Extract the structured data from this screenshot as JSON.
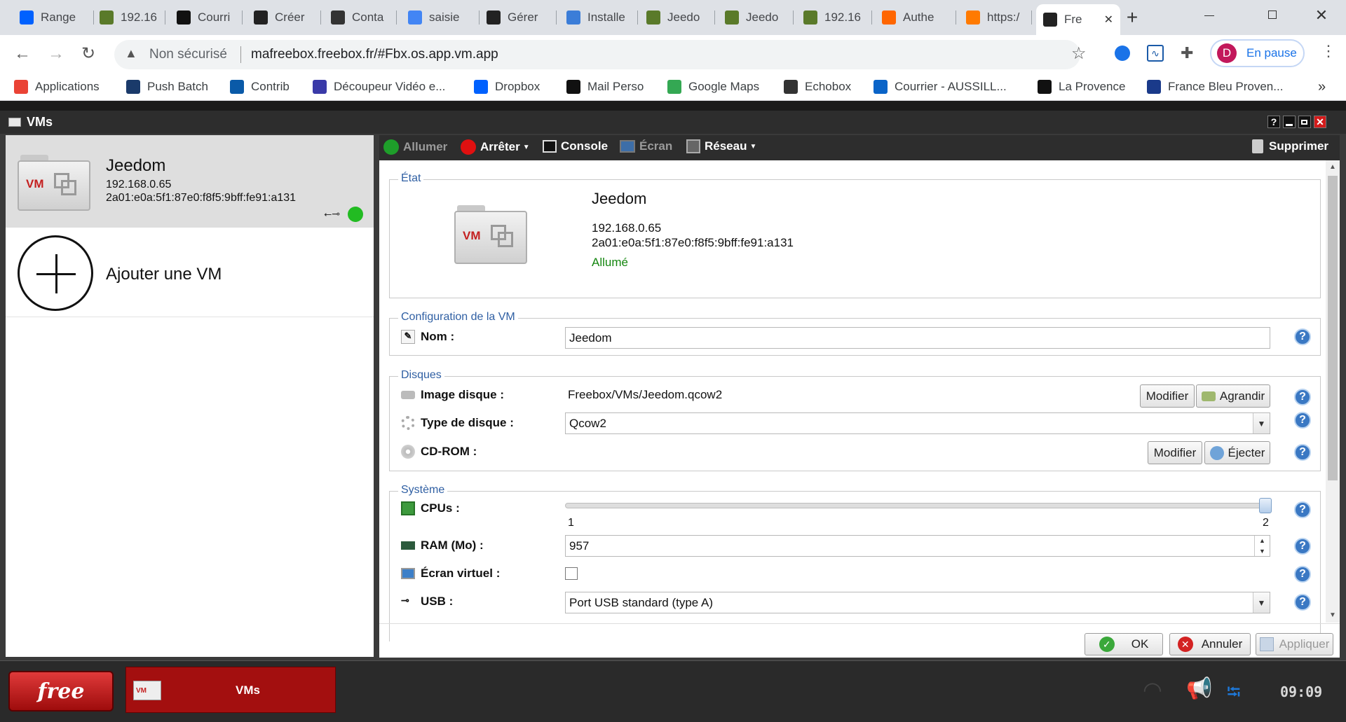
{
  "browser": {
    "tabs": [
      {
        "label": "Range",
        "icon": "dropbox-icon",
        "color": "#0061fe"
      },
      {
        "label": "192.16",
        "icon": "house-icon",
        "color": "#5a7a2a"
      },
      {
        "label": "Courri",
        "icon": "mail-icon",
        "color": "#111111"
      },
      {
        "label": "Créer",
        "icon": "qr-icon",
        "color": "#222222"
      },
      {
        "label": "Conta",
        "icon": "contact-icon",
        "color": "#333333"
      },
      {
        "label": "saisie",
        "icon": "google-icon",
        "color": "#4285f4"
      },
      {
        "label": "Gérer",
        "icon": "f-icon",
        "color": "#222222"
      },
      {
        "label": "Installe",
        "icon": "globe-icon",
        "color": "#3b7dd8"
      },
      {
        "label": "Jeedo",
        "icon": "house-icon",
        "color": "#5a7a2a"
      },
      {
        "label": "Jeedo",
        "icon": "house-icon",
        "color": "#5a7a2a"
      },
      {
        "label": "192.16",
        "icon": "house-icon",
        "color": "#5a7a2a"
      },
      {
        "label": "Authe",
        "icon": "orange-icon",
        "color": "#ff6600"
      },
      {
        "label": "https:/",
        "icon": "circle-icon",
        "color": "#ff7a00"
      },
      {
        "label": "Fre",
        "icon": "freebox-icon",
        "color": "#222222"
      }
    ],
    "security_label": "Non sécurisé",
    "url": "mafreebox.freebox.fr/#Fbx.os.app.vm.app",
    "profile_initial": "D",
    "profile_status": "En pause",
    "bookmarks": [
      {
        "label": "Applications",
        "icon": "apps-grid-icon"
      },
      {
        "label": "Push Batch",
        "icon": "b-icon"
      },
      {
        "label": "Contrib",
        "icon": "drupal-icon"
      },
      {
        "label": "Découpeur Vidéo e...",
        "icon": "film-icon"
      },
      {
        "label": "Dropbox",
        "icon": "dropbox-icon"
      },
      {
        "label": "Mail Perso",
        "icon": "mail-icon"
      },
      {
        "label": "Google Maps",
        "icon": "map-pin-icon"
      },
      {
        "label": "Echobox",
        "icon": "echobox-icon"
      },
      {
        "label": "Courrier - AUSSILL...",
        "icon": "outlook-icon"
      },
      {
        "label": "La Provence",
        "icon": "p-icon"
      },
      {
        "label": "France Bleu Proven...",
        "icon": "radio-icon"
      }
    ],
    "more_bookmarks": "»"
  },
  "app": {
    "window_title": "VMs",
    "vm_list": [
      {
        "name": "Jeedom",
        "ipv4": "192.168.0.65",
        "ipv6": "2a01:e0a:5f1:87e0:f8f5:9bff:fe91:a131",
        "status_color": "#22bb22"
      }
    ],
    "add_vm_label": "Ajouter une VM",
    "toolbar": {
      "start": "Allumer",
      "stop": "Arrêter",
      "console": "Console",
      "screen": "Écran",
      "network": "Réseau",
      "delete": "Supprimer"
    },
    "state": {
      "legend": "État",
      "name": "Jeedom",
      "ipv4": "192.168.0.65",
      "ipv6": "2a01:e0a:5f1:87e0:f8f5:9bff:fe91:a131",
      "status": "Allumé"
    },
    "config": {
      "legend": "Configuration de la VM",
      "name_label": "Nom :",
      "name_value": "Jeedom"
    },
    "disks": {
      "legend": "Disques",
      "image_label": "Image disque :",
      "image_value": "Freebox/VMs/Jeedom.qcow2",
      "modify": "Modifier",
      "enlarge": "Agrandir",
      "type_label": "Type de disque :",
      "type_value": "Qcow2",
      "cdrom_label": "CD-ROM :",
      "cdrom_modify": "Modifier",
      "eject": "Éjecter"
    },
    "system": {
      "legend": "Système",
      "cpus_label": "CPUs :",
      "cpus_min": "1",
      "cpus_max": "2",
      "cpus_value": 2,
      "ram_label": "RAM (Mo) :",
      "ram_value": "957",
      "virtual_screen_label": "Écran virtuel :",
      "virtual_screen_checked": false,
      "usb_label": "USB :",
      "usb_value": "Port USB standard (type A)"
    },
    "footer": {
      "ok": "OK",
      "cancel": "Annuler",
      "apply": "Appliquer"
    },
    "help_glyph": "?"
  },
  "taskbar": {
    "logo": "free",
    "active_app": "VMs",
    "clock": "09:09"
  }
}
